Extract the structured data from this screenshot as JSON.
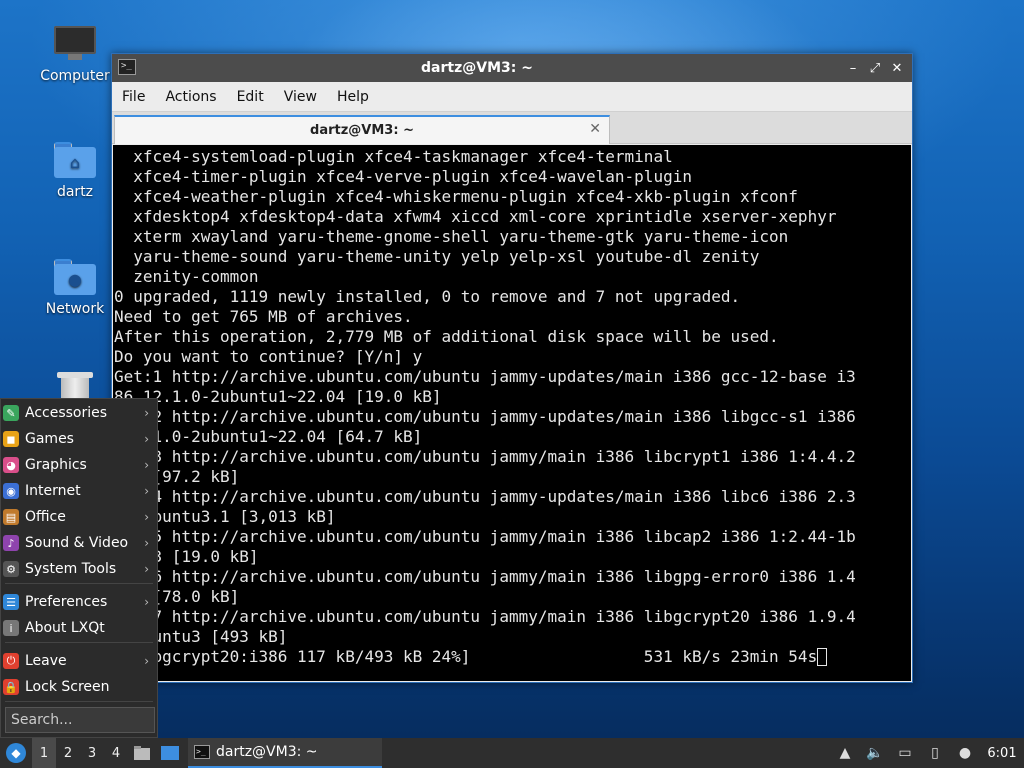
{
  "desktop": {
    "icons": [
      {
        "label": "Computer"
      },
      {
        "label": "dartz"
      },
      {
        "label": "Network"
      },
      {
        "label": ""
      }
    ]
  },
  "window": {
    "title": "dartz@VM3: ~",
    "menu": [
      "File",
      "Actions",
      "Edit",
      "View",
      "Help"
    ],
    "tab_label": "dartz@VM3: ~",
    "terminal_lines": [
      "  xfce4-systemload-plugin xfce4-taskmanager xfce4-terminal",
      "  xfce4-timer-plugin xfce4-verve-plugin xfce4-wavelan-plugin",
      "  xfce4-weather-plugin xfce4-whiskermenu-plugin xfce4-xkb-plugin xfconf",
      "  xfdesktop4 xfdesktop4-data xfwm4 xiccd xml-core xprintidle xserver-xephyr",
      "  xterm xwayland yaru-theme-gnome-shell yaru-theme-gtk yaru-theme-icon",
      "  yaru-theme-sound yaru-theme-unity yelp yelp-xsl youtube-dl zenity",
      "  zenity-common",
      "0 upgraded, 1119 newly installed, 0 to remove and 7 not upgraded.",
      "Need to get 765 MB of archives.",
      "After this operation, 2,779 MB of additional disk space will be used.",
      "Do you want to continue? [Y/n] y",
      "Get:1 http://archive.ubuntu.com/ubuntu jammy-updates/main i386 gcc-12-base i3",
      "86 12.1.0-2ubuntu1~22.04 [19.0 kB]",
      "Get:2 http://archive.ubuntu.com/ubuntu jammy-updates/main i386 libgcc-s1 i386",
      " 12.1.0-2ubuntu1~22.04 [64.7 kB]",
      "Get:3 http://archive.ubuntu.com/ubuntu jammy/main i386 libcrypt1 i386 1:4.4.2",
      "7-4 [97.2 kB]",
      "Get:4 http://archive.ubuntu.com/ubuntu jammy-updates/main i386 libc6 i386 2.3",
      "5-0ubuntu3.1 [3,013 kB]",
      "Get:5 http://archive.ubuntu.com/ubuntu jammy/main i386 libcap2 i386 1:2.44-1b",
      "uild3 [19.0 kB]",
      "Get:6 http://archive.ubuntu.com/ubuntu jammy/main i386 libgpg-error0 i386 1.4",
      "3-3 [78.0 kB]",
      "Get:7 http://archive.ubuntu.com/ubuntu jammy/main i386 libgcrypt20 i386 1.9.4",
      "-3ubuntu3 [493 kB]",
      "7 libgcrypt20:i386 117 kB/493 kB 24%]                  531 kB/s 23min 54s"
    ]
  },
  "start_menu": {
    "items": [
      {
        "label": "Accessories",
        "icon": "accessories-icon",
        "color": "#3aa55d",
        "submenu": true
      },
      {
        "label": "Games",
        "icon": "games-icon",
        "color": "#e8a317",
        "submenu": true
      },
      {
        "label": "Graphics",
        "icon": "graphics-icon",
        "color": "#d94f8a",
        "submenu": true
      },
      {
        "label": "Internet",
        "icon": "internet-icon",
        "color": "#3b6fd4",
        "submenu": true
      },
      {
        "label": "Office",
        "icon": "office-icon",
        "color": "#c07a2c",
        "submenu": true
      },
      {
        "label": "Sound & Video",
        "icon": "sound-video-icon",
        "color": "#8e44ad",
        "submenu": true
      },
      {
        "label": "System Tools",
        "icon": "system-tools-icon",
        "color": "#555555",
        "submenu": true
      },
      {
        "label": "Preferences",
        "icon": "preferences-icon",
        "color": "#2f87d8",
        "submenu": true
      },
      {
        "label": "About LXQt",
        "icon": "about-icon",
        "color": "#777777",
        "submenu": false
      },
      {
        "label": "Leave",
        "icon": "leave-icon",
        "color": "#e0402f",
        "submenu": true
      },
      {
        "label": "Lock Screen",
        "icon": "lock-icon",
        "color": "#e0402f",
        "submenu": false
      }
    ],
    "search_placeholder": "Search..."
  },
  "taskbar": {
    "workspaces": [
      "1",
      "2",
      "3",
      "4"
    ],
    "active_workspace": "1",
    "task_label": "dartz@VM3: ~",
    "clock": "6:01"
  }
}
